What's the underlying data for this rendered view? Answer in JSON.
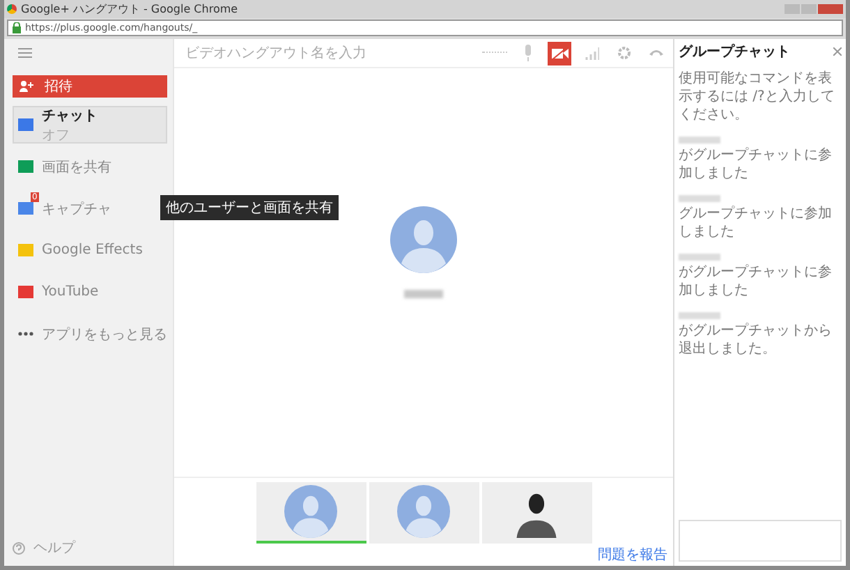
{
  "window": {
    "title": "Google+ ハングアウト - Google Chrome",
    "url": "https://plus.google.com/hangouts/_"
  },
  "invite_button": {
    "label": "招待"
  },
  "sidebar": {
    "items": [
      {
        "kind": "chat",
        "label": "チャット",
        "sublabel": "オフ",
        "selected": true
      },
      {
        "kind": "screen",
        "label": "画面を共有",
        "selected": false
      },
      {
        "kind": "capture",
        "label": "キャプチャ",
        "badge": "0",
        "selected": false
      },
      {
        "kind": "effects",
        "label": "Google Effects",
        "selected": false
      },
      {
        "kind": "youtube",
        "label": "YouTube",
        "selected": false
      },
      {
        "kind": "more",
        "label": "アプリをもっと見る",
        "selected": false
      }
    ],
    "help": "ヘルプ"
  },
  "tooltip": "他のユーザーと画面を共有",
  "name_field": {
    "placeholder": "ビデオハングアウト名を入力"
  },
  "toolbar": [
    {
      "kind": "mic",
      "on": false
    },
    {
      "kind": "camera",
      "on": true
    },
    {
      "kind": "signal",
      "on": false
    },
    {
      "kind": "settings",
      "on": false
    },
    {
      "kind": "hangup",
      "on": false
    }
  ],
  "thumbnails": [
    {
      "kind": "avatar",
      "selected": true
    },
    {
      "kind": "avatar",
      "selected": false
    },
    {
      "kind": "photo",
      "selected": false
    }
  ],
  "report_link": "問題を報告",
  "chat": {
    "title": "グループチャット",
    "messages": [
      {
        "text": "使用可能なコマンドを表示するには /?と入力してください。",
        "blurred_name": false
      },
      {
        "text": "がグループチャットに参加しました",
        "blurred_name": true
      },
      {
        "text": "グループチャットに参加しました",
        "blurred_name": true
      },
      {
        "text": "がグループチャットに参加しました",
        "blurred_name": true
      },
      {
        "text": "がグループチャットから退出しました。",
        "blurred_name": true
      }
    ]
  }
}
